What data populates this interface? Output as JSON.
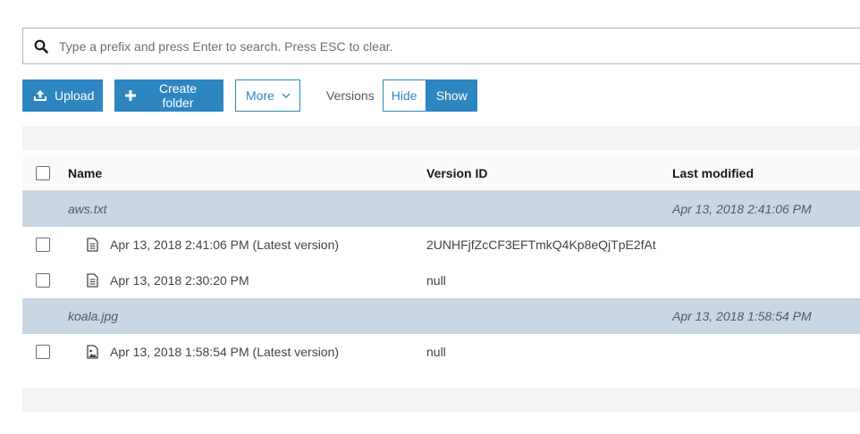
{
  "search": {
    "placeholder": "Type a prefix and press Enter to search. Press ESC to clear.",
    "icon": "search-icon"
  },
  "toolbar": {
    "upload_label": "Upload",
    "create_folder_label": "Create folder",
    "more_label": "More",
    "versions_label": "Versions",
    "hide_label": "Hide",
    "show_label": "Show",
    "accent_color": "#2e86c1"
  },
  "table": {
    "columns": {
      "name": "Name",
      "version_id": "Version ID",
      "last_modified": "Last modified"
    },
    "rows": [
      {
        "type": "object",
        "name": "aws.txt",
        "last_modified": "Apr 13, 2018 2:41:06 PM"
      },
      {
        "type": "version",
        "icon": "document-icon",
        "name": "Apr 13, 2018 2:41:06 PM (Latest version)",
        "version_id": "2UNHFjfZcCF3EFTmkQ4Kp8eQjTpE2fAt"
      },
      {
        "type": "version",
        "icon": "document-icon",
        "name": "Apr 13, 2018 2:30:20 PM",
        "version_id": "null"
      },
      {
        "type": "object",
        "name": "koala.jpg",
        "last_modified": "Apr 13, 2018 1:58:54 PM"
      },
      {
        "type": "version",
        "icon": "image-icon",
        "name": "Apr 13, 2018 1:58:54 PM (Latest version)",
        "version_id": "null"
      }
    ],
    "group_row_color": "#c9d6e3"
  }
}
